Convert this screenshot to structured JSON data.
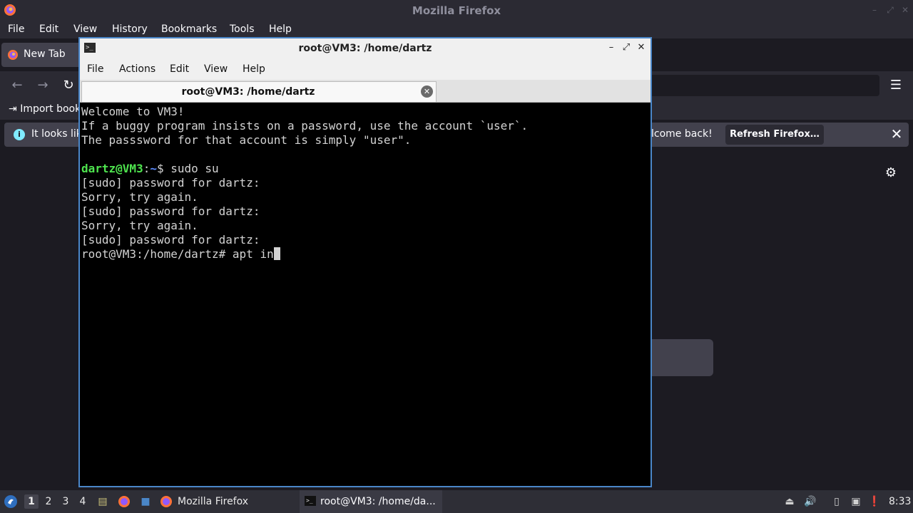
{
  "firefox": {
    "window_title": "Mozilla Firefox",
    "menu": [
      "File",
      "Edit",
      "View",
      "History",
      "Bookmarks",
      "Tools",
      "Help"
    ],
    "tab_label": "New Tab",
    "bookmarks_item": "Import book",
    "notice_text": "It looks lik",
    "notice_text_right": "lcome back!",
    "refresh_button": "Refresh Firefox…"
  },
  "terminal": {
    "window_title": "root@VM3: /home/dartz",
    "menu": [
      "File",
      "Actions",
      "Edit",
      "View",
      "Help"
    ],
    "tab_label": "root@VM3: /home/dartz",
    "lines": [
      "Welcome to VM3!",
      "If a buggy program insists on a password, use the account `user`.",
      "The passsword for that account is simply \"user\".",
      "",
      "",
      "[sudo] password for dartz:",
      "Sorry, try again.",
      "[sudo] password for dartz:",
      "Sorry, try again.",
      "[sudo] password for dartz:",
      ""
    ],
    "prompt_user": "dartz@VM3",
    "prompt_sep": ":",
    "prompt_path": "~",
    "prompt_cmd": "$ sudo su",
    "root_line": "root@VM3:/home/dartz# apt in"
  },
  "taskbar": {
    "workspaces": [
      "1",
      "2",
      "3",
      "4"
    ],
    "active_workspace": "1",
    "task_firefox": "Mozilla Firefox",
    "task_terminal": "root@VM3: /home/da...",
    "clock": "8:33"
  }
}
